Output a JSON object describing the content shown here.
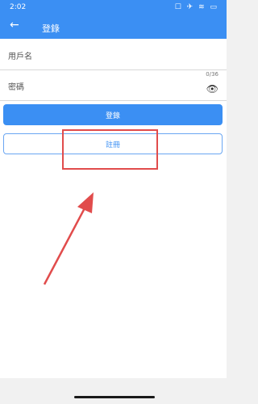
{
  "status_bar": {
    "time": "2:02",
    "icons": "☐ ✈ ≋ ▭"
  },
  "app_bar": {
    "back_icon": "arrow-left-icon",
    "title": "登錄"
  },
  "form": {
    "username_label": "用戶名",
    "password_label": "密碼",
    "password_counter": "0/36",
    "eye_icon": "eye-icon"
  },
  "buttons": {
    "login": "登錄",
    "register": "註冊"
  },
  "colors": {
    "primary": "#3b8ff3",
    "annotation": "#e14c4c"
  }
}
